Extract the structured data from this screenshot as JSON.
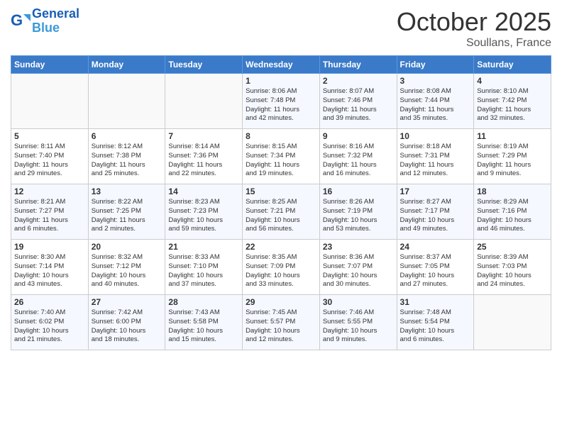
{
  "header": {
    "logo_line1": "General",
    "logo_line2": "Blue",
    "month": "October 2025",
    "location": "Soullans, France"
  },
  "weekdays": [
    "Sunday",
    "Monday",
    "Tuesday",
    "Wednesday",
    "Thursday",
    "Friday",
    "Saturday"
  ],
  "weeks": [
    [
      {
        "day": "",
        "info": ""
      },
      {
        "day": "",
        "info": ""
      },
      {
        "day": "",
        "info": ""
      },
      {
        "day": "1",
        "info": "Sunrise: 8:06 AM\nSunset: 7:48 PM\nDaylight: 11 hours\nand 42 minutes."
      },
      {
        "day": "2",
        "info": "Sunrise: 8:07 AM\nSunset: 7:46 PM\nDaylight: 11 hours\nand 39 minutes."
      },
      {
        "day": "3",
        "info": "Sunrise: 8:08 AM\nSunset: 7:44 PM\nDaylight: 11 hours\nand 35 minutes."
      },
      {
        "day": "4",
        "info": "Sunrise: 8:10 AM\nSunset: 7:42 PM\nDaylight: 11 hours\nand 32 minutes."
      }
    ],
    [
      {
        "day": "5",
        "info": "Sunrise: 8:11 AM\nSunset: 7:40 PM\nDaylight: 11 hours\nand 29 minutes."
      },
      {
        "day": "6",
        "info": "Sunrise: 8:12 AM\nSunset: 7:38 PM\nDaylight: 11 hours\nand 25 minutes."
      },
      {
        "day": "7",
        "info": "Sunrise: 8:14 AM\nSunset: 7:36 PM\nDaylight: 11 hours\nand 22 minutes."
      },
      {
        "day": "8",
        "info": "Sunrise: 8:15 AM\nSunset: 7:34 PM\nDaylight: 11 hours\nand 19 minutes."
      },
      {
        "day": "9",
        "info": "Sunrise: 8:16 AM\nSunset: 7:32 PM\nDaylight: 11 hours\nand 16 minutes."
      },
      {
        "day": "10",
        "info": "Sunrise: 8:18 AM\nSunset: 7:31 PM\nDaylight: 11 hours\nand 12 minutes."
      },
      {
        "day": "11",
        "info": "Sunrise: 8:19 AM\nSunset: 7:29 PM\nDaylight: 11 hours\nand 9 minutes."
      }
    ],
    [
      {
        "day": "12",
        "info": "Sunrise: 8:21 AM\nSunset: 7:27 PM\nDaylight: 11 hours\nand 6 minutes."
      },
      {
        "day": "13",
        "info": "Sunrise: 8:22 AM\nSunset: 7:25 PM\nDaylight: 11 hours\nand 2 minutes."
      },
      {
        "day": "14",
        "info": "Sunrise: 8:23 AM\nSunset: 7:23 PM\nDaylight: 10 hours\nand 59 minutes."
      },
      {
        "day": "15",
        "info": "Sunrise: 8:25 AM\nSunset: 7:21 PM\nDaylight: 10 hours\nand 56 minutes."
      },
      {
        "day": "16",
        "info": "Sunrise: 8:26 AM\nSunset: 7:19 PM\nDaylight: 10 hours\nand 53 minutes."
      },
      {
        "day": "17",
        "info": "Sunrise: 8:27 AM\nSunset: 7:17 PM\nDaylight: 10 hours\nand 49 minutes."
      },
      {
        "day": "18",
        "info": "Sunrise: 8:29 AM\nSunset: 7:16 PM\nDaylight: 10 hours\nand 46 minutes."
      }
    ],
    [
      {
        "day": "19",
        "info": "Sunrise: 8:30 AM\nSunset: 7:14 PM\nDaylight: 10 hours\nand 43 minutes."
      },
      {
        "day": "20",
        "info": "Sunrise: 8:32 AM\nSunset: 7:12 PM\nDaylight: 10 hours\nand 40 minutes."
      },
      {
        "day": "21",
        "info": "Sunrise: 8:33 AM\nSunset: 7:10 PM\nDaylight: 10 hours\nand 37 minutes."
      },
      {
        "day": "22",
        "info": "Sunrise: 8:35 AM\nSunset: 7:09 PM\nDaylight: 10 hours\nand 33 minutes."
      },
      {
        "day": "23",
        "info": "Sunrise: 8:36 AM\nSunset: 7:07 PM\nDaylight: 10 hours\nand 30 minutes."
      },
      {
        "day": "24",
        "info": "Sunrise: 8:37 AM\nSunset: 7:05 PM\nDaylight: 10 hours\nand 27 minutes."
      },
      {
        "day": "25",
        "info": "Sunrise: 8:39 AM\nSunset: 7:03 PM\nDaylight: 10 hours\nand 24 minutes."
      }
    ],
    [
      {
        "day": "26",
        "info": "Sunrise: 7:40 AM\nSunset: 6:02 PM\nDaylight: 10 hours\nand 21 minutes."
      },
      {
        "day": "27",
        "info": "Sunrise: 7:42 AM\nSunset: 6:00 PM\nDaylight: 10 hours\nand 18 minutes."
      },
      {
        "day": "28",
        "info": "Sunrise: 7:43 AM\nSunset: 5:58 PM\nDaylight: 10 hours\nand 15 minutes."
      },
      {
        "day": "29",
        "info": "Sunrise: 7:45 AM\nSunset: 5:57 PM\nDaylight: 10 hours\nand 12 minutes."
      },
      {
        "day": "30",
        "info": "Sunrise: 7:46 AM\nSunset: 5:55 PM\nDaylight: 10 hours\nand 9 minutes."
      },
      {
        "day": "31",
        "info": "Sunrise: 7:48 AM\nSunset: 5:54 PM\nDaylight: 10 hours\nand 6 minutes."
      },
      {
        "day": "",
        "info": ""
      }
    ]
  ]
}
